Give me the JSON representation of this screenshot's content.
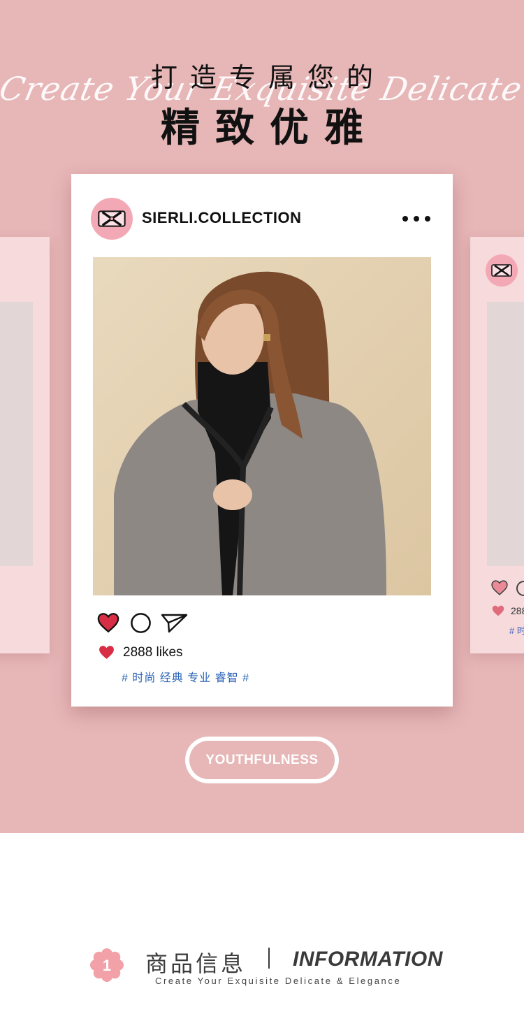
{
  "hero": {
    "script_line": "Create Your Exquisite Delicate & Elegance",
    "headline_1": "打造专属您的",
    "headline_2": "精致优雅",
    "background_color": "#e7b6b7"
  },
  "post": {
    "username": "SIERLI.COLLECTION",
    "avatar_icon": "brand-monogram-icon",
    "more_icon": "more-dots-icon",
    "actions": [
      "heart-icon",
      "comment-icon",
      "share-send-icon"
    ],
    "likes": "2888 likes",
    "tags": "# 时尚 经典 专业 睿智 #",
    "photo_alt": "model-wearing-grey-boucle-cardigan"
  },
  "side_card_right": {
    "likes_partial": "288",
    "tags_partial": "# 时"
  },
  "badge": {
    "label": "YOUTHFULNESS"
  },
  "info": {
    "number": "1",
    "title_cn": "商品信息",
    "title_en": "INFORMATION",
    "subtitle": "Create Your Exquisite Delicate & Elegance"
  },
  "colors": {
    "pink_bg": "#e7b6b7",
    "card_pink": "#f6dadc",
    "heart_red": "#d72e45",
    "tag_blue": "#2b63b7"
  }
}
